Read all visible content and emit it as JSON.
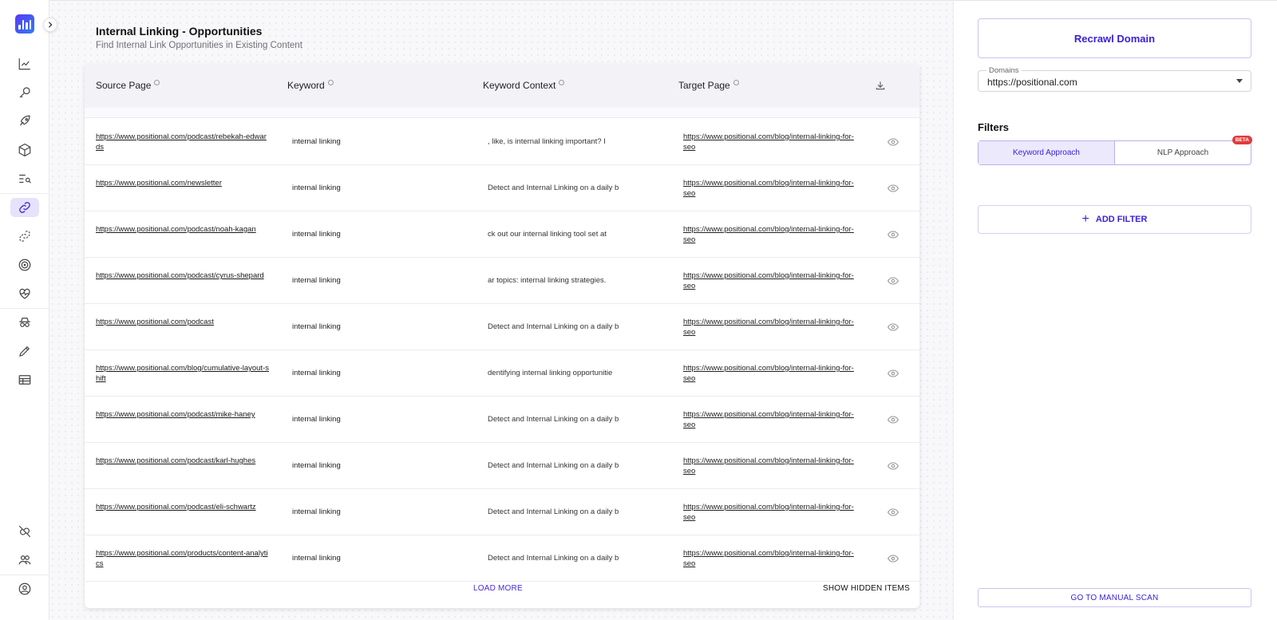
{
  "page": {
    "title": "Internal Linking - Opportunities",
    "subtitle": "Find Internal Link Opportunities in Existing Content"
  },
  "sidebar": {
    "items": [
      {
        "icon": "trend-chart-icon"
      },
      {
        "icon": "key-icon"
      },
      {
        "icon": "rocket-icon"
      },
      {
        "icon": "cube-icon"
      },
      {
        "icon": "list-search-icon"
      },
      {
        "icon": "link-icon",
        "active": true
      },
      {
        "icon": "broken-link-icon"
      },
      {
        "icon": "target-icon"
      },
      {
        "icon": "heart-pulse-icon"
      },
      {
        "icon": "spy-icon"
      },
      {
        "icon": "pencil-icon"
      },
      {
        "icon": "table-icon"
      },
      {
        "icon": "plug-off-icon"
      },
      {
        "icon": "users-icon"
      },
      {
        "icon": "account-icon"
      }
    ]
  },
  "table": {
    "headers": [
      "Source Page",
      "Keyword",
      "Keyword Context",
      "Target Page"
    ],
    "rows": [
      {
        "source": "https://www.positional.com/podcast/rebekah-edwards",
        "keyword": "internal linking",
        "context": ", like, is internal linking important? I",
        "target": "https://www.positional.com/blog/internal-linking-for-seo"
      },
      {
        "source": "https://www.positional.com/newsletter",
        "keyword": "internal linking",
        "context": "Detect and Internal Linking on a daily b",
        "target": "https://www.positional.com/blog/internal-linking-for-seo"
      },
      {
        "source": "https://www.positional.com/podcast/noah-kagan",
        "keyword": "internal linking",
        "context": "ck out our internal linking tool set at",
        "target": "https://www.positional.com/blog/internal-linking-for-seo"
      },
      {
        "source": "https://www.positional.com/podcast/cyrus-shepard",
        "keyword": "internal linking",
        "context": "ar topics: internal linking strategies.",
        "target": "https://www.positional.com/blog/internal-linking-for-seo"
      },
      {
        "source": "https://www.positional.com/podcast",
        "keyword": "internal linking",
        "context": "Detect and Internal Linking on a daily b",
        "target": "https://www.positional.com/blog/internal-linking-for-seo"
      },
      {
        "source": "https://www.positional.com/blog/cumulative-layout-shift",
        "keyword": "internal linking",
        "context": "dentifying internal linking opportunitie",
        "target": "https://www.positional.com/blog/internal-linking-for-seo"
      },
      {
        "source": "https://www.positional.com/podcast/mike-haney",
        "keyword": "internal linking",
        "context": "Detect and Internal Linking on a daily b",
        "target": "https://www.positional.com/blog/internal-linking-for-seo"
      },
      {
        "source": "https://www.positional.com/podcast/karl-hughes",
        "keyword": "internal linking",
        "context": "Detect and Internal Linking on a daily b",
        "target": "https://www.positional.com/blog/internal-linking-for-seo"
      },
      {
        "source": "https://www.positional.com/podcast/eli-schwartz",
        "keyword": "internal linking",
        "context": "Detect and Internal Linking on a daily b",
        "target": "https://www.positional.com/blog/internal-linking-for-seo"
      },
      {
        "source": "https://www.positional.com/products/content-analytics",
        "keyword": "internal linking",
        "context": "Detect and Internal Linking on a daily b",
        "target": "https://www.positional.com/blog/internal-linking-for-seo"
      }
    ],
    "load_more": "LOAD MORE",
    "show_hidden": "SHOW HIDDEN ITEMS"
  },
  "right_panel": {
    "recrawl_label": "Recrawl Domain",
    "domains_label": "Domains",
    "domains_value": "https://positional.com",
    "filters_title": "Filters",
    "approach_keyword": "Keyword Approach",
    "approach_nlp": "NLP Approach",
    "beta_badge": "BETA",
    "add_filter": "ADD FILTER",
    "manual_scan": "GO TO MANUAL SCAN"
  },
  "colors": {
    "accent": "#3b1ed8",
    "active_nav_bg": "#e6e2fb",
    "beta_red": "#e23b3b"
  }
}
